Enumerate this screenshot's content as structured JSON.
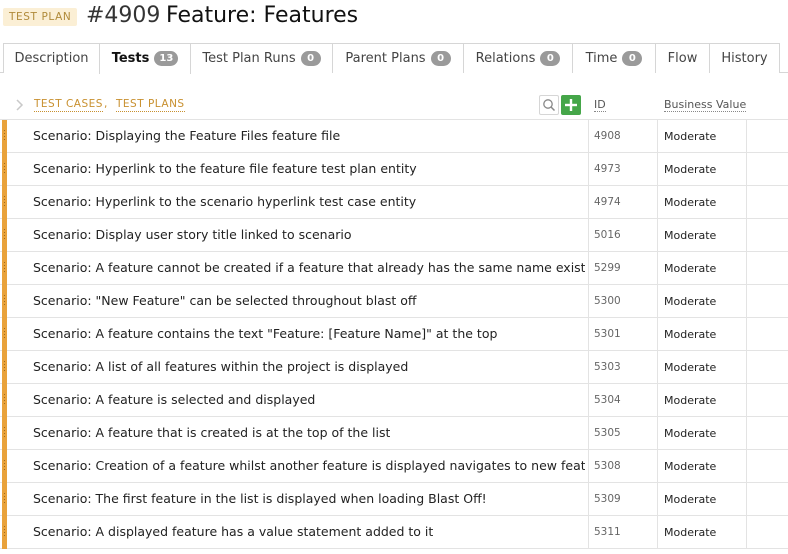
{
  "header": {
    "type_badge": "TEST PLAN",
    "entity_id": "#4909",
    "entity_title": "Feature: Features"
  },
  "tabs": [
    {
      "label": "Description",
      "count": null
    },
    {
      "label": "Tests",
      "count": "13",
      "active": true
    },
    {
      "label": "Test Plan Runs",
      "count": "0"
    },
    {
      "label": "Parent Plans",
      "count": "0"
    },
    {
      "label": "Relations",
      "count": "0"
    },
    {
      "label": "Time",
      "count": "0"
    },
    {
      "label": "Flow",
      "count": null
    },
    {
      "label": "History",
      "count": null
    }
  ],
  "list": {
    "header_test_cases": "TEST CASES",
    "header_separator": ",",
    "header_test_plans": "TEST PLANS",
    "col_id": "ID",
    "col_business_value": "Business Value",
    "accent_color": "#e9a23b",
    "add_button_color": "#45a649",
    "rows": [
      {
        "name": "Scenario: Displaying the Feature Files feature file",
        "id": "4908",
        "business_value": "Moderate"
      },
      {
        "name": "Scenario: Hyperlink to the feature file feature test plan entity",
        "id": "4973",
        "business_value": "Moderate"
      },
      {
        "name": "Scenario: Hyperlink to the scenario hyperlink test case entity",
        "id": "4974",
        "business_value": "Moderate"
      },
      {
        "name": "Scenario: Display user story title linked to scenario",
        "id": "5016",
        "business_value": "Moderate"
      },
      {
        "name": "Scenario: A feature cannot be created if a feature that already has the same name exists",
        "id": "5299",
        "business_value": "Moderate"
      },
      {
        "name": "Scenario: \"New Feature\" can be selected throughout blast off",
        "id": "5300",
        "business_value": "Moderate"
      },
      {
        "name": "Scenario: A feature contains the text \"Feature: [Feature Name]\" at the top",
        "id": "5301",
        "business_value": "Moderate"
      },
      {
        "name": "Scenario: A list of all features within the project is displayed",
        "id": "5303",
        "business_value": "Moderate"
      },
      {
        "name": "Scenario: A feature is selected and displayed",
        "id": "5304",
        "business_value": "Moderate"
      },
      {
        "name": "Scenario: A feature that is created is at the top of the list",
        "id": "5305",
        "business_value": "Moderate"
      },
      {
        "name": "Scenario: Creation of a feature whilst another feature is displayed navigates to new feature",
        "id": "5308",
        "business_value": "Moderate"
      },
      {
        "name": "Scenario: The first feature in the list is displayed when loading Blast Off!",
        "id": "5309",
        "business_value": "Moderate"
      },
      {
        "name": "Scenario: A displayed feature has a value statement added to it",
        "id": "5311",
        "business_value": "Moderate"
      }
    ]
  }
}
